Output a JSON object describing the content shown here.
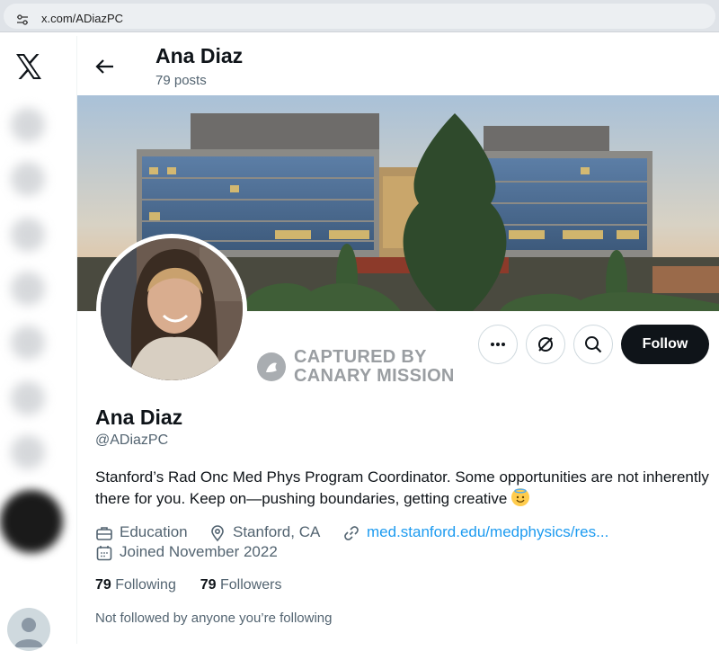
{
  "browser": {
    "url": "x.com/ADiazPC"
  },
  "header": {
    "name": "Ana Diaz",
    "posts": "79 posts"
  },
  "watermark": {
    "line1": "CAPTURED BY",
    "line2": "CANARY MISSION"
  },
  "actions": {
    "follow_label": "Follow"
  },
  "profile": {
    "name": "Ana Diaz",
    "handle": "@ADiazPC",
    "bio": "Stanford’s Rad Onc Med Phys Program Coordinator. Some opportunities are not inherently there for you. Keep on—pushing boundaries, getting creative",
    "category": "Education",
    "location": "Stanford, CA",
    "website": "med.stanford.edu/medphysics/res...",
    "joined": "Joined November 2022",
    "following_count": "79",
    "following_label": "Following",
    "followers_count": "79",
    "followers_label": "Followers",
    "not_followed_note": "Not followed by anyone you’re following"
  },
  "icons": {
    "site_info": "tune-icon",
    "logo": "x-logo-icon",
    "back": "arrow-left-icon",
    "more": "more-horizontal-icon",
    "grok": "grok-icon",
    "search": "search-icon",
    "category": "briefcase-icon",
    "location": "location-pin-icon",
    "link": "link-icon",
    "calendar": "calendar-icon",
    "bio_emoji": "smiling-face-with-halo-emoji"
  },
  "colors": {
    "follow_button": "#0f1419",
    "link": "#1d9bf0",
    "secondary_text": "#536471"
  }
}
